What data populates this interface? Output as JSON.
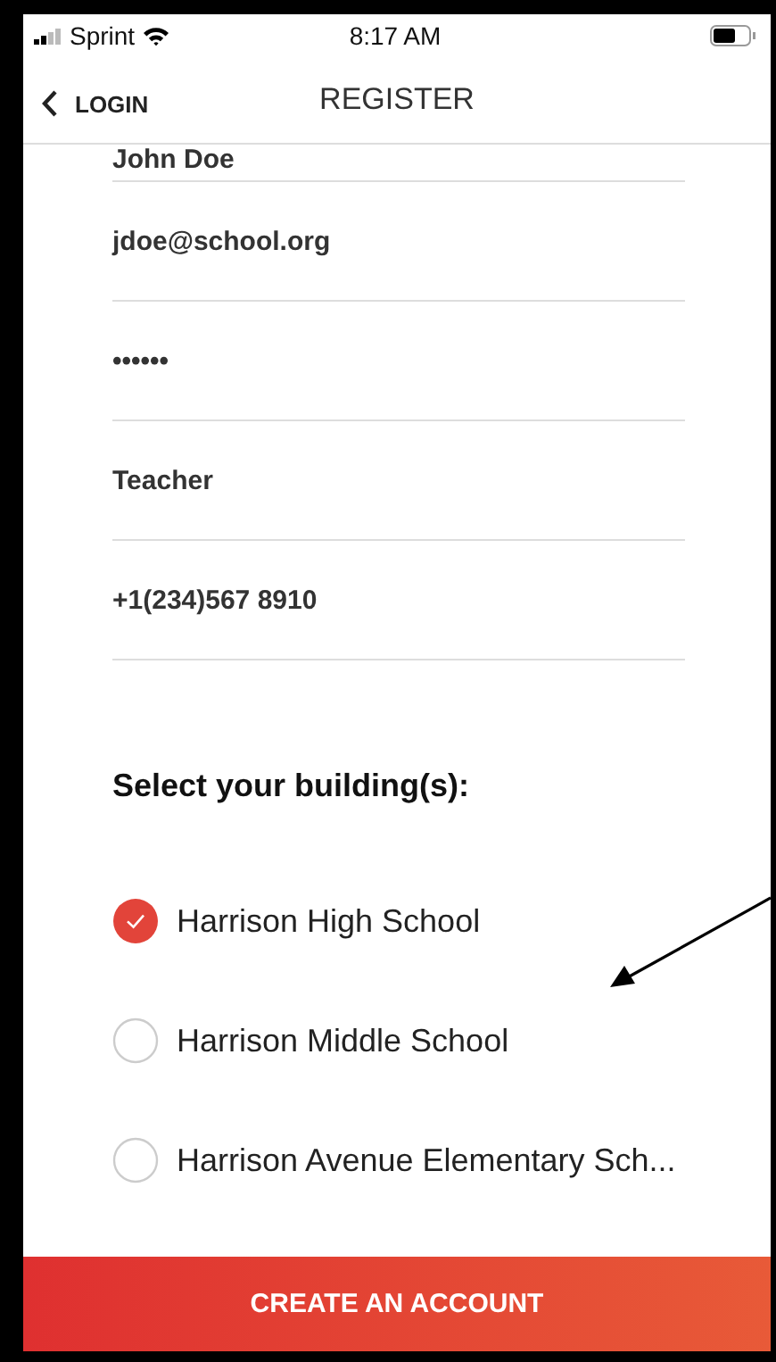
{
  "status_bar": {
    "carrier": "Sprint",
    "time": "8:17 AM"
  },
  "nav": {
    "back_label": "LOGIN",
    "title": "REGISTER"
  },
  "fields": [
    {
      "value": "John Doe"
    },
    {
      "value": "jdoe@school.org"
    },
    {
      "value": "••••••"
    },
    {
      "value": "Teacher"
    },
    {
      "value": "+1(234)567 8910"
    }
  ],
  "buildings_heading": "Select your building(s):",
  "buildings": [
    {
      "label": "Harrison High School",
      "selected": true
    },
    {
      "label": "Harrison Middle School",
      "selected": false
    },
    {
      "label": "Harrison Avenue Elementary Sch...",
      "selected": false
    }
  ],
  "submit_button": "CREATE AN ACCOUNT"
}
